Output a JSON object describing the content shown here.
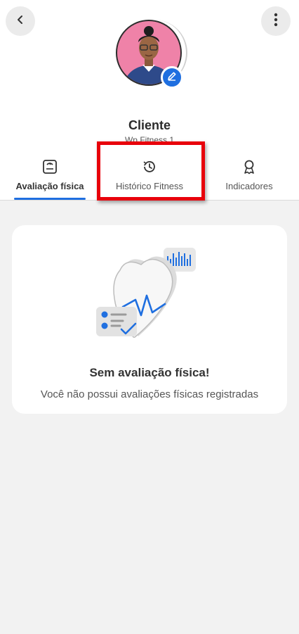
{
  "header": {
    "back_icon": "chevron-left-icon",
    "more_icon": "more-vertical-icon",
    "client_name": "Cliente",
    "client_subtitle": "Wp Fitness 1"
  },
  "avatar": {
    "edit_icon": "pencil-icon",
    "background": "#ef82a8"
  },
  "tabs": [
    {
      "label": "Avaliação física",
      "icon": "scale-icon",
      "active": true
    },
    {
      "label": "Histórico Fitness",
      "icon": "history-icon",
      "active": false
    },
    {
      "label": "Indicadores",
      "icon": "award-icon",
      "active": false
    }
  ],
  "empty_state": {
    "title": "Sem avaliação física!",
    "description": "Você não possui avaliações físicas registradas"
  },
  "colors": {
    "accent": "#1f6fe0",
    "highlight": "#e8000b",
    "background": "#f2f2f2"
  }
}
